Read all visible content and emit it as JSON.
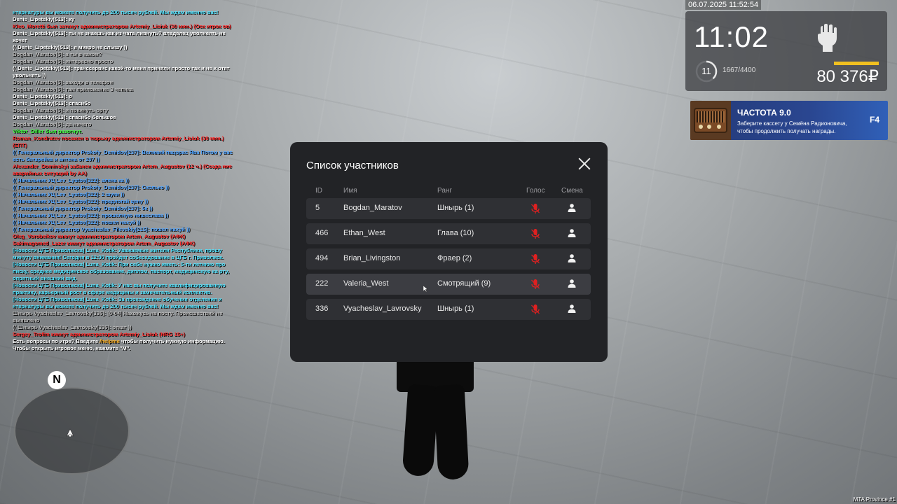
{
  "chat": [
    {
      "text": "нтернатуры вы можете получить до 200 тысяч рублей. Мы ждем именно вас!",
      "color": "cyan"
    },
    {
      "text": "Denis_Lipetskiy[513]: ку",
      "color": "white"
    },
    {
      "text": "Kleo_Moretti был заткнут администратором Artemiy_Lisiuk (30 мин.) (Оск игрок ов)",
      "color": "red"
    },
    {
      "text": "Denis_Lipetskiy[513]: ты не знаешь как из чата ливнуть? владелец уволнеять не хочет",
      "color": "white"
    },
    {
      "text": "(( Denis_Lipetskiy[513]: я микро не слышу ))",
      "color": "white"
    },
    {
      "text": "Bogdan_Maratov[5]: а ты в каком?",
      "color": "grey"
    },
    {
      "text": "Bogdan_Maratov[5]: интересно просто",
      "color": "grey"
    },
    {
      "text": "(( Denis_Lipetskiy[513]: транссервис какой-то меня приняли просто так и не х отят увольнять ))",
      "color": "white"
    },
    {
      "text": "Bogdan_Maratov[5]: заходи в телефон",
      "color": "grey"
    },
    {
      "text": "Bogdan_Maratov[5]: там приложение 3 чепика",
      "color": "grey"
    },
    {
      "text": "Denis_Lipetskiy[513]: о",
      "color": "white"
    },
    {
      "text": "Denis_Lipetskiy[513]: спасибо",
      "color": "white"
    },
    {
      "text": "Bogdan_Maratov[5]: и покинуть оргу",
      "color": "grey"
    },
    {
      "text": "Denis_Lipetskiy[513]: спасибо большое",
      "color": "white"
    },
    {
      "text": "Bogdan_Maratov[5]: да ничего",
      "color": "grey"
    },
    {
      "text": "Viktor_Diller был разогнут.",
      "color": "green"
    },
    {
      "text": "Roman_Kondratev посажен в тюрьму администратором Artemiy_Lisiuk (30 мин.) (ЕПТ)",
      "color": "red"
    },
    {
      "text": "(( Генеральный директор Prokofy_Demidov[237]: Великий пацорас Ява Потом у вас есть батарейка и антена от 207 ))",
      "color": "blue"
    },
    {
      "text": "Alexander_Dominskyi забанен администратором Artem_Augustov (12 ч.) (Созда ние аварийных ситуаций by AA)",
      "color": "red"
    },
    {
      "text": "(( Начальник УЦ Lev_Lyutov[322]: алена ка ))",
      "color": "blue"
    },
    {
      "text": "(( Генеральный директор Prokofy_Demidov[237]: Сколько ))",
      "color": "blue"
    },
    {
      "text": "(( Начальник УЦ Lev_Lyutov[322]: 2 шуки ))",
      "color": "blue"
    },
    {
      "text": "(( Начальник УЦ Lev_Lyutov[322]: предлогай цену ))",
      "color": "blue"
    },
    {
      "text": "(( Генеральный директор Prokofy_Demidov[237]: 5к ))",
      "color": "blue"
    },
    {
      "text": "(( Начальник УЦ Lev_Lyutov[322]: прошелную нишеслава ))",
      "color": "blue"
    },
    {
      "text": "(( Начальник УЦ Lev_Lyutov[322]: пошел нахуй ))",
      "color": "blue"
    },
    {
      "text": "(( Генеральный директор Vyacheslav_Filevskiy[215]: пошел нахуй ))",
      "color": "blue"
    },
    {
      "text": "Oleg_Vorobeikov кикнут администратором Artem_Augustov (АФК)",
      "color": "red"
    },
    {
      "text": "Sakimagomed_Lazer кикнут администратором Artem_Augustov (АФК)",
      "color": "red"
    },
    {
      "text": "[Новости ЦГБ Приволжска] Luna_Kotik: Уважаемые жители Республики, прошу минуту внимания! Сегодня в 12:00 пройдет собеседование в ЦГБ г. Приволжск.",
      "color": "cyan"
    },
    {
      "text": "[Новости ЦГБ Приволжска] Luna_Kotik: При себе нужно иметь: 5-ти летнюю про писку, среднее медицинское образование, диплом, паспорт, медицинскую ка рту, опрятный внешний вид.",
      "color": "cyan"
    },
    {
      "text": "[Новости ЦГБ Приволжска] Luna_Kotik: У нас вы получите квалифицированную практику, карьерный рост в сфере медицины и замечательный коллектив.",
      "color": "cyan"
    },
    {
      "text": "[Новости ЦГБ Приволжска] Luna_Kotik: За прохождение обучения отделения и нтернатуры вы можете получить до 200 тысяч рублей. Мы ждем именно вас!",
      "color": "cyan"
    },
    {
      "text": "Шнырь Vyacheslav_Lavrovsky[336]: [0-04] Нахожусь на посту. Происшествий не выявлено",
      "color": "grey"
    },
    {
      "text": "(( Шнырь Vyacheslav_Lavrovsky[336]: откат ))",
      "color": "grey"
    },
    {
      "text": "Sergey_Trofim кикнут администратором Artemiy_Lisiuk (NRG 15+)",
      "color": "red"
    },
    {
      "text_parts": [
        "Есть вопросы по игре? Введите ",
        "/helpme",
        " чтобы получить нужную информацию."
      ],
      "color": "white"
    },
    {
      "text": "Чтобы открыть игровое меню, нажмите \"M\".",
      "color": "white"
    }
  ],
  "hud": {
    "datetime": "06.07.2025 11:52:54",
    "time": "11:02",
    "level": "11",
    "xp": "1667/4400",
    "xp_fraction": 0.379,
    "money": "80 376₽",
    "fist_icon": "fist-icon"
  },
  "radio": {
    "title": "ЧАСТОТА 9.0",
    "text": "Заберите кассету у Семёна Радионовича, чтобы продолжить получать награды.",
    "key": "F4"
  },
  "modal": {
    "title": "Список участников",
    "columns": {
      "id": "ID",
      "name": "Имя",
      "rank": "Ранг",
      "voice": "Голос",
      "swap": "Смена"
    },
    "rows": [
      {
        "id": "5",
        "name": "Bogdan_Maratov",
        "rank": "Шнырь (1)"
      },
      {
        "id": "466",
        "name": "Ethan_West",
        "rank": "Глава (10)"
      },
      {
        "id": "494",
        "name": "Brian_Livingston",
        "rank": "Фраер (2)"
      },
      {
        "id": "222",
        "name": "Valeria_West",
        "rank": "Смотрящий (9)"
      },
      {
        "id": "336",
        "name": "Vyacheslav_Lavrovsky",
        "rank": "Шнырь (1)"
      }
    ]
  },
  "minimap": {
    "north": "N"
  },
  "server": "MTA Province #1",
  "colors": {
    "mic_red": "#e02020",
    "money_bar": "#f0c020",
    "radio_bg": "#2a4690"
  }
}
